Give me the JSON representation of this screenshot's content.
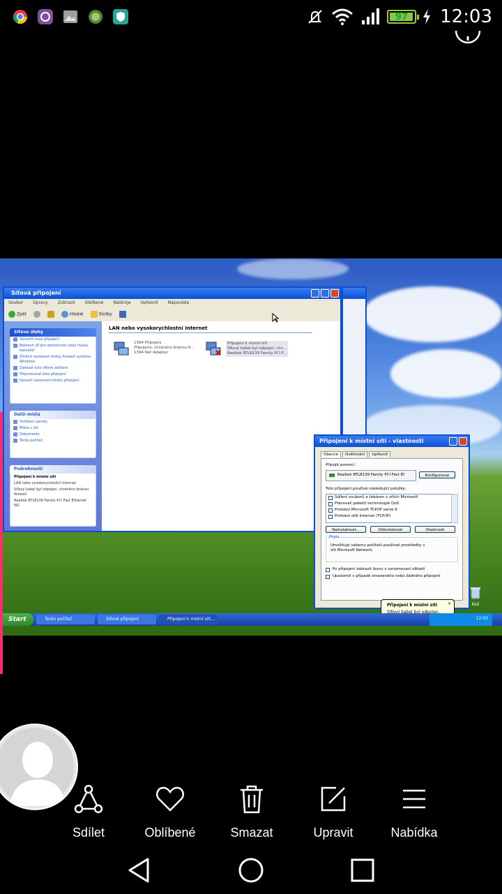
{
  "status_bar": {
    "time": "12:03",
    "battery_level": "97",
    "notification_icons": [
      "chrome-icon",
      "viber-icon",
      "gallery-icon",
      "game-icon",
      "shield-icon"
    ],
    "system_icons": [
      "mute-icon",
      "wifi-icon",
      "signal-icon",
      "battery-icon",
      "charging-icon"
    ]
  },
  "photo": {
    "explorer": {
      "title": "Síťová připojení",
      "menu": [
        "Soubor",
        "Úpravy",
        "Zobrazit",
        "Oblíbené",
        "Nástroje",
        "Upřesnit",
        "Nápověda"
      ],
      "toolbar": {
        "back": "Zpět",
        "search": "Hledat",
        "folders": "Složky"
      },
      "tasks_panel": {
        "title": "Síťové úlohy",
        "items": [
          "Vytvořit nové připojení",
          "Nastavit síť pro domácnost nebo malou kancelář",
          "Změnit nastavení brány firewall systému Windows",
          "Zakázat toto síťové zařízení",
          "Přejmenovat toto připojení",
          "Upravit nastavení tohoto připojení"
        ]
      },
      "other_places_panel": {
        "title": "Další místa",
        "items": [
          "Ovládací panely",
          "Místa v síti",
          "Dokumenty",
          "Tento počítač"
        ]
      },
      "details_panel": {
        "title": "Podrobnosti",
        "name": "Připojení k místní síti",
        "lines": [
          "LAN nebo vysokorychlostní Internet",
          "Síťový kabel byl odpojen, chráněno bránou firewall",
          "Realtek RTL8139 Family PCI Fast Ethernet NIC"
        ]
      },
      "group_header": "LAN nebo vysokorychlostní Internet",
      "connections": [
        {
          "name": "1394 Připojení",
          "status": "Připojeno, chráněno bránou fi...",
          "device": "1394 Net Adapter"
        },
        {
          "name": "Připojení k místní síti",
          "status": "Síťový kabel byl odpojen, chr...",
          "device": "Realtek RTL8139 Family PCI F..."
        }
      ]
    },
    "dialog": {
      "title": "Připojení k místní síti - vlastnosti",
      "tabs": [
        "Obecné",
        "Ověřování",
        "Upřesnit"
      ],
      "connect_using_label": "Připojit pomocí:",
      "adapter": "Realtek RTL8139 Family PCI Fast Et",
      "configure_button": "Konfigurovat",
      "items_label": "Toto připojení používá následující položky:",
      "items": [
        "Sdílení souborů a tiskáren v sítích Microsoft",
        "Plánovač paketů technologie QoS",
        "Protokol Microsoft TCP/IP verze 6",
        "Protokol sítě Internet (TCP/IP)"
      ],
      "install_button": "Nainstalovat...",
      "uninstall_button": "Odinstalovat",
      "properties_button": "Vlastnosti",
      "description_label": "Popis",
      "description": "Umožňuje vašemu počítači používat prostředky v síti Microsoft Network.",
      "check_show_icon": "Po připojení zobrazit ikonu v oznamovací oblasti",
      "check_notify": "Upozornit v případě omezeného nebo žádného připojení"
    },
    "balloon": {
      "title": "Připojení k místní síti",
      "text": "Síťový kabel byl odpojen."
    },
    "taskbar": {
      "start": "Start",
      "tasks": [
        "Tento počítač",
        "Síťová připojení",
        "Připojení k místní síti..."
      ],
      "clock": "12:03"
    },
    "desktop_icon": "Koš"
  },
  "viewer_actions": [
    {
      "label": "Sdílet",
      "icon": "share-icon"
    },
    {
      "label": "Oblíbené",
      "icon": "heart-icon"
    },
    {
      "label": "Smazat",
      "icon": "trash-icon"
    },
    {
      "label": "Upravit",
      "icon": "edit-icon"
    },
    {
      "label": "Nabídka",
      "icon": "menu-icon"
    }
  ],
  "nav_bar": [
    "back-icon",
    "home-icon",
    "recents-icon"
  ]
}
